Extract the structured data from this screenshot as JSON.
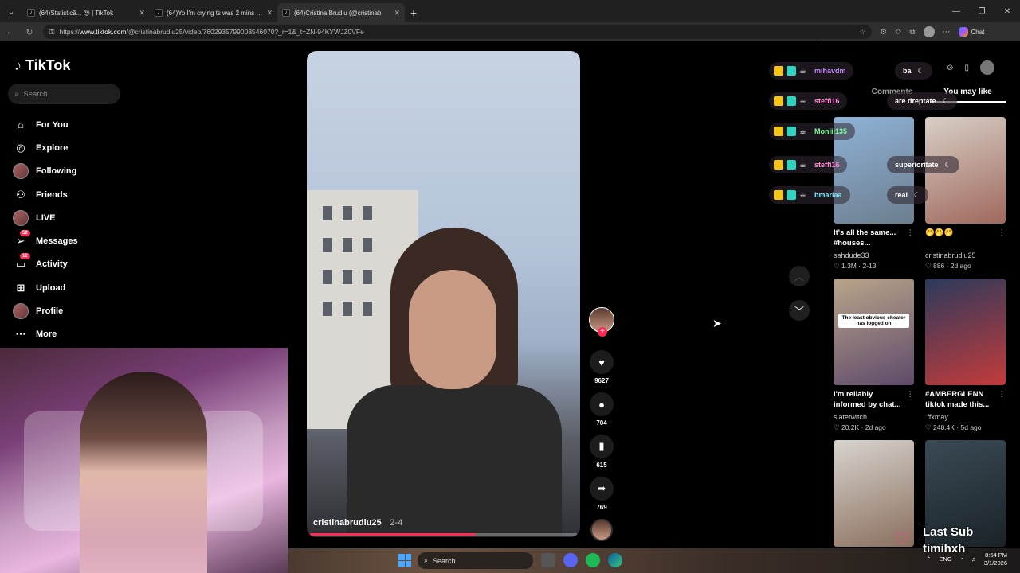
{
  "browser": {
    "tabs": [
      {
        "title": "(64)Statistică... 😍 | TikTok",
        "active": false
      },
      {
        "title": "(64)Yo I'm crying ts was 2 mins aw",
        "active": false
      },
      {
        "title": "(64)Cristina Brudiu (@cristinab",
        "active": true
      }
    ],
    "url_prefix": "https://",
    "url_host": "www.tiktok.com",
    "url_path": "/@cristinabrudiu25/video/7602935799008546070?_r=1&_t=ZN-94KYWJZ0VFe",
    "copilot_label": "Chat"
  },
  "sidebar": {
    "logo": "TikTok",
    "search_placeholder": "Search",
    "items": [
      {
        "label": "For You",
        "icon": "home-icon",
        "badge": ""
      },
      {
        "label": "Explore",
        "icon": "compass-icon",
        "badge": ""
      },
      {
        "label": "Following",
        "icon": "avatar-icon",
        "badge": ""
      },
      {
        "label": "Friends",
        "icon": "friends-icon",
        "badge": ""
      },
      {
        "label": "LIVE",
        "icon": "live-avatar-icon",
        "badge": ""
      },
      {
        "label": "Messages",
        "icon": "send-icon",
        "badge": "52"
      },
      {
        "label": "Activity",
        "icon": "inbox-icon",
        "badge": "12"
      },
      {
        "label": "Upload",
        "icon": "plus-square-icon",
        "badge": ""
      },
      {
        "label": "Profile",
        "icon": "profile-icon",
        "badge": ""
      },
      {
        "label": "More",
        "icon": "more-icon",
        "badge": ""
      }
    ]
  },
  "video": {
    "author": "cristinabrudiu25",
    "date": "· 2-4",
    "progress": 0.62,
    "likes": "9627",
    "comments": "704",
    "saves": "615",
    "shares": "769"
  },
  "right_panel": {
    "tabs": [
      "Comments",
      "You may like"
    ],
    "active_tab": "You may like",
    "cards": [
      {
        "title": "It's all the same... #houses...",
        "author": "sahdude33",
        "likes": "1.3M",
        "date": "2-13",
        "thumb_text": "",
        "colors": [
          "#8fb2d6",
          "#6c7e8f"
        ]
      },
      {
        "title": "🤭🤭🤭",
        "author": "cristinabrudiu25",
        "likes": "886",
        "date": "2d ago",
        "thumb_text": "",
        "colors": [
          "#d7cfc6",
          "#a0685d"
        ]
      },
      {
        "title": "I'm reliably informed by chat...",
        "author": "slatetwitch",
        "likes": "20.2K",
        "date": "2d ago",
        "thumb_text": "The least obvious cheater has logged on",
        "colors": [
          "#b9a58a",
          "#5e4a6a"
        ]
      },
      {
        "title": "#AMBERGLENN tiktok made this...",
        "author": ".ffxmay",
        "likes": "248.4K",
        "date": "5d ago",
        "thumb_text": "",
        "colors": [
          "#2b3a5c",
          "#c33b3b"
        ]
      },
      {
        "title": "",
        "author": "",
        "likes": "",
        "date": "",
        "thumb_text": "",
        "colors": [
          "#d8d4cf",
          "#8a6f5d"
        ]
      },
      {
        "title": "",
        "author": "",
        "likes": "",
        "date": "",
        "thumb_text": "",
        "colors": [
          "#3a4a55",
          "#1a2328"
        ]
      }
    ]
  },
  "chat": {
    "users": [
      {
        "name": "mihavdm",
        "color": "#c68cff"
      },
      {
        "name": "steffi16",
        "color": "#ff8ad6"
      },
      {
        "name": "Moniii135",
        "color": "#7effa0"
      },
      {
        "name": "steffi16",
        "color": "#ff8ad6"
      },
      {
        "name": "bmariaa",
        "color": "#7ee8ff"
      }
    ],
    "messages": [
      "ba",
      "are dreptate",
      "superioritate",
      "real"
    ]
  },
  "overlay": {
    "last_sub_label": "Last Sub",
    "last_sub_user": "timihxh"
  },
  "taskbar": {
    "search_label": "Search",
    "lang": "ENG",
    "time": "8:54 PM",
    "date": "3/1/2026"
  }
}
